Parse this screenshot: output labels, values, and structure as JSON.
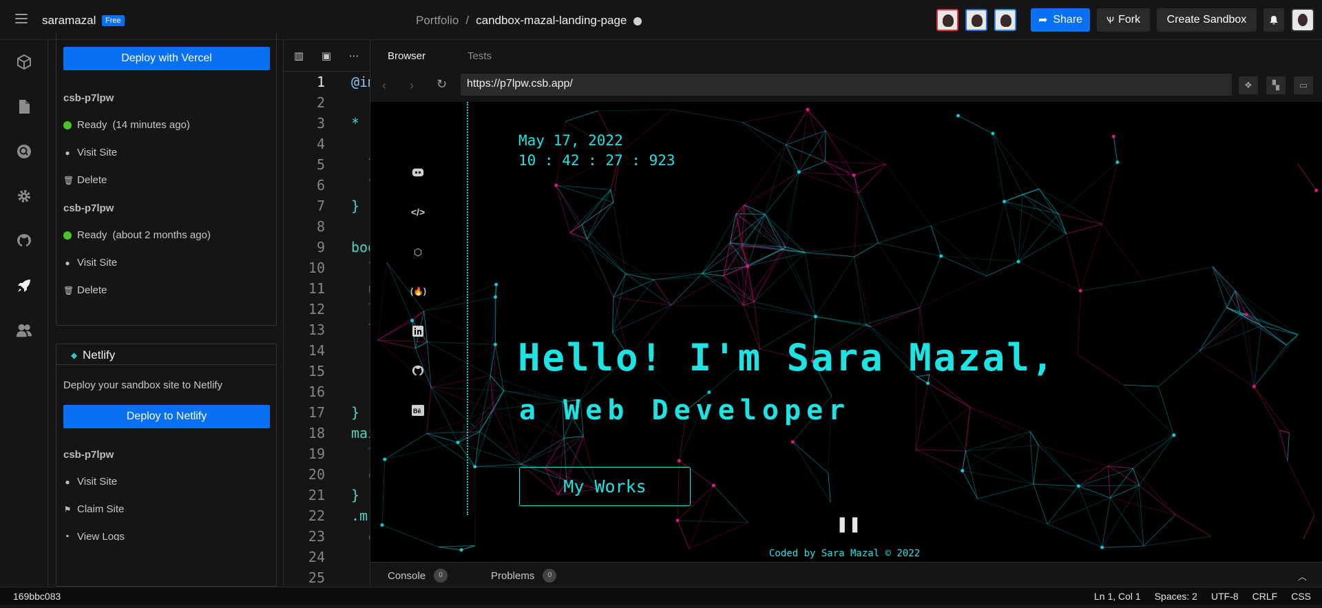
{
  "topbar": {
    "username": "saramazal",
    "badge": "Free",
    "breadcrumb_parent": "Portfolio",
    "breadcrumb_sep": "/",
    "project_name": "candbox-mazal-landing-page",
    "share_label": "Share",
    "fork_label": "Fork",
    "create_label": "Create Sandbox"
  },
  "sidebar": {
    "icons": [
      "cube-icon",
      "file-icon",
      "search-icon",
      "gear-icon",
      "github-icon",
      "rocket-icon",
      "users-icon"
    ],
    "active_icon": "rocket-icon"
  },
  "vercel": {
    "deploy_label": "Deploy with Vercel",
    "deployments": [
      {
        "name": "csb-p7lpw",
        "status": "Ready",
        "time": "(14 minutes ago)",
        "visit": "Visit Site",
        "delete": "Delete"
      },
      {
        "name": "csb-p7lpw",
        "status": "Ready",
        "time": "(about 2 months ago)",
        "visit": "Visit Site",
        "delete": "Delete"
      }
    ]
  },
  "netlify": {
    "title": "Netlify",
    "description": "Deploy your sandbox site to Netlify",
    "deploy_label": "Deploy to Netlify",
    "site_name": "csb-p7lpw",
    "visit": "Visit Site",
    "claim": "Claim Site",
    "logs": "View Logs"
  },
  "editor": {
    "line_numbers": [
      "1",
      "2",
      "3",
      "4",
      "5",
      "6",
      "7",
      "8",
      "9",
      "10",
      "11",
      "12",
      "13",
      "14",
      "15",
      "16",
      "17",
      "18",
      "19",
      "20",
      "21",
      "22",
      "23",
      "24",
      "25"
    ],
    "lines": [
      "@im",
      "",
      "*",
      " r",
      " l",
      " l",
      "}",
      "",
      "bod",
      " l",
      " u",
      " l",
      " l",
      " -",
      " -",
      " -",
      "}",
      "mai",
      " l",
      " c",
      "}",
      ".m",
      " c",
      "",
      " -"
    ]
  },
  "browser": {
    "tab_browser": "Browser",
    "tab_tests": "Tests",
    "url": "https://p7lpw.csb.app/",
    "page": {
      "date": "May 17, 2022",
      "time": "10 : 42 : 27 : 923",
      "hero_line1": "Hello! I'm Sara Mazal,",
      "hero_line2": "a Web Developer",
      "cta": "My Works",
      "footer": "Coded by Sara Mazal © 2022",
      "social_icons": [
        "discord-icon",
        "code-icon",
        "codepen-icon",
        "freecodecamp-icon",
        "linkedin-icon",
        "github-icon",
        "behance-icon"
      ]
    },
    "console_label": "Console",
    "console_count": "0",
    "problems_label": "Problems",
    "problems_count": "0"
  },
  "statusbar": {
    "commit": "169bbc083",
    "cursor": "Ln 1, Col 1",
    "spaces": "Spaces: 2",
    "encoding": "UTF-8",
    "eol": "CRLF",
    "language": "CSS"
  },
  "colors": {
    "accent": "#0971f1",
    "cyan": "#1ee3e3",
    "magenta": "#ff1f8e",
    "ready": "#4cc22b"
  }
}
